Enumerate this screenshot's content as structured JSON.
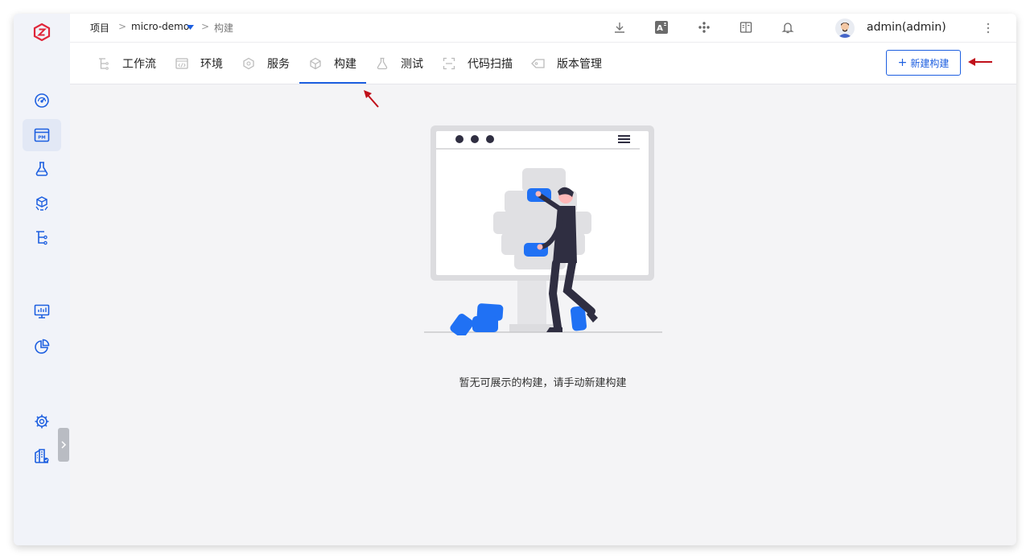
{
  "breadcrumb": {
    "root": "项目",
    "sep1": ">",
    "project": "micro-demo",
    "sep2": ">",
    "current": "构建"
  },
  "topbar": {
    "icons": [
      "download-icon",
      "translate-icon",
      "cluster-icon",
      "docs-icon",
      "bell-icon"
    ],
    "username": "admin(admin)"
  },
  "sidebar": {
    "icons": [
      "dashboard-icon",
      "project-icon",
      "test-icon",
      "artifact-icon",
      "workflow-icon",
      "monitor-icon",
      "report-icon",
      "settings-icon",
      "building-icon"
    ]
  },
  "tabs": [
    {
      "label": "工作流",
      "icon": "workflow-icon"
    },
    {
      "label": "环境",
      "icon": "environment-icon"
    },
    {
      "label": "服务",
      "icon": "service-icon"
    },
    {
      "label": "构建",
      "icon": "build-icon",
      "active": true
    },
    {
      "label": "测试",
      "icon": "test-icon"
    },
    {
      "label": "代码扫描",
      "icon": "scan-icon"
    },
    {
      "label": "版本管理",
      "icon": "version-icon"
    }
  ],
  "actions": {
    "new_build": "新建构建"
  },
  "empty_state": {
    "message": "暂无可展示的构建，请手动新建构建"
  },
  "colors": {
    "accent": "#1d5fe0",
    "annotation": "#c0101a",
    "logo": "#e0263a"
  }
}
